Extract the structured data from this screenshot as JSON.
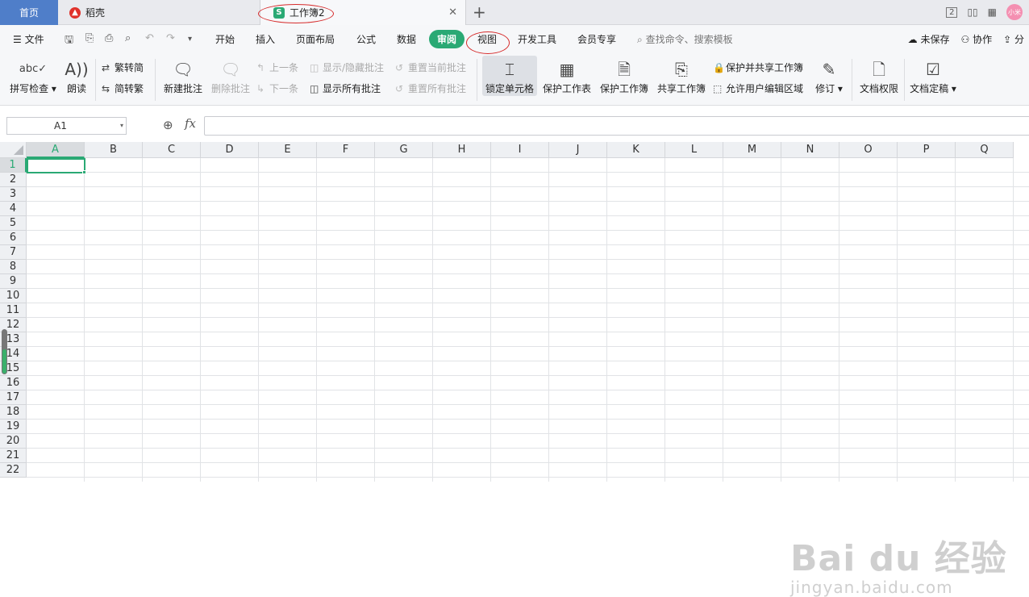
{
  "titlebar": {
    "tab_home": "首页",
    "tab_daoke": "稻壳",
    "tab_workbook": "工作簿2",
    "workbook_logo_letter": "S",
    "close_glyph": "✕",
    "add_glyph": "+",
    "counter": "2",
    "avatar_text": "小米"
  },
  "menubar": {
    "file": "文件",
    "items": [
      "开始",
      "插入",
      "页面布局",
      "公式",
      "数据",
      "审阅",
      "视图",
      "开发工具",
      "会员专享"
    ],
    "active": "审阅",
    "search": "查找命令、搜索模板",
    "unsaved": "未保存",
    "collab": "协作",
    "share": "分"
  },
  "ribbon": {
    "spell_check": "拼写检查",
    "read_aloud": "朗读",
    "trad_to_simp": "繁转简",
    "simp_to_trad": "简转繁",
    "new_comment": "新建批注",
    "delete_comment": "删除批注",
    "prev": "上一条",
    "next": "下一条",
    "show_hide_comment": "显示/隐藏批注",
    "show_all_comments": "显示所有批注",
    "reset_current_comment": "重置当前批注",
    "reset_all_comments": "重置所有批注",
    "lock_cell": "锁定单元格",
    "protect_sheet": "保护工作表",
    "protect_workbook": "保护工作簿",
    "share_workbook": "共享工作簿",
    "protect_share_workbook": "保护并共享工作簿",
    "allow_edit_ranges": "允许用户编辑区域",
    "revise": "修订",
    "doc_permission": "文档权限",
    "doc_finalize": "文档定稿"
  },
  "formula": {
    "name_box": "A1",
    "fx": "fx",
    "value": ""
  },
  "sheet": {
    "columns": [
      "A",
      "B",
      "C",
      "D",
      "E",
      "F",
      "G",
      "H",
      "I",
      "J",
      "K",
      "L",
      "M",
      "N",
      "O",
      "P",
      "Q"
    ],
    "rows": [
      "1",
      "2",
      "3",
      "4",
      "5",
      "6",
      "7",
      "8",
      "9",
      "10",
      "11",
      "12",
      "13",
      "14",
      "15",
      "16",
      "17",
      "18",
      "19",
      "20",
      "21",
      "22"
    ],
    "active_column": "A",
    "active_row": "1"
  },
  "watermark": {
    "main": "Bai du 经验",
    "sub": "jingyan.baidu.com"
  },
  "colors": {
    "accent_green": "#2aa974",
    "home_tab_blue": "#4f7ec9",
    "annotation_red": "#d62b2b"
  }
}
